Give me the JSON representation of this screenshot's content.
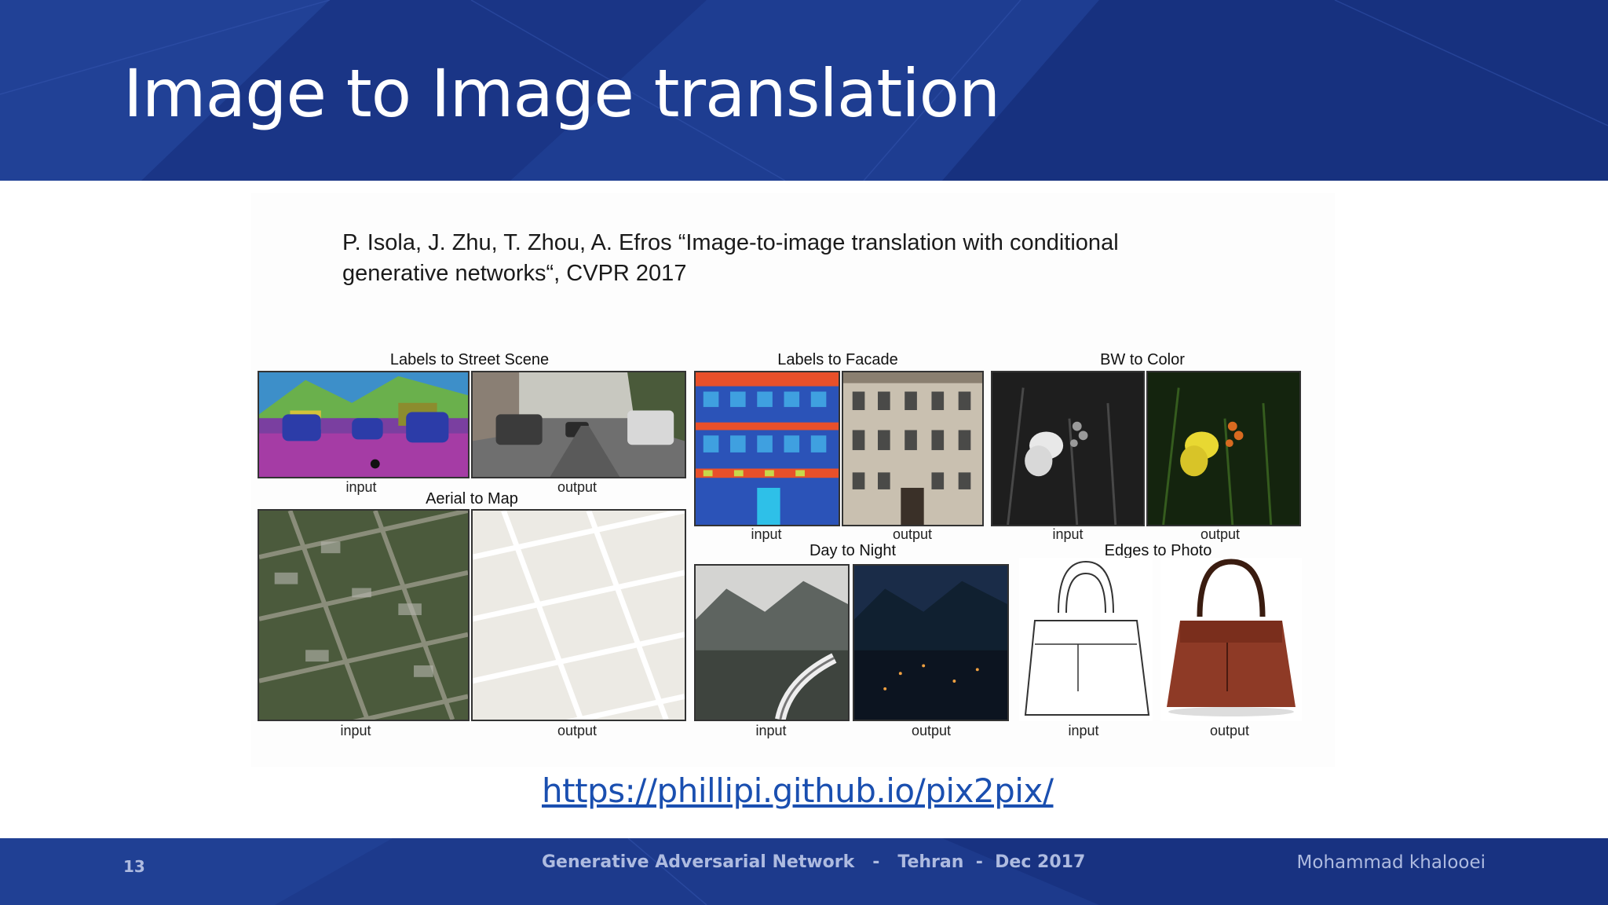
{
  "slide": {
    "title": "Image to Image translation",
    "citation_line1": "P. Isola, J. Zhu, T. Zhou, A. Efros “Image-to-image translation with conditional",
    "citation_line2": "generative networks“, CVPR 2017",
    "link": "https://phillipi.github.io/pix2pix/"
  },
  "figure": {
    "panels": [
      {
        "title": "Labels to Street Scene",
        "input": "input",
        "output": "output"
      },
      {
        "title": "Aerial to Map",
        "input": "input",
        "output": "output"
      },
      {
        "title": "Labels to Facade",
        "input": "input",
        "output": "output"
      },
      {
        "title": "BW to Color",
        "input": "input",
        "output": "output"
      },
      {
        "title": "Day to Night",
        "input": "input",
        "output": "output"
      },
      {
        "title": "Edges to Photo",
        "input": "input",
        "output": "output"
      }
    ]
  },
  "footer": {
    "page_number": "13",
    "center": "Generative Adversarial Network   -   Tehran  -  Dec 2017",
    "author": "Mohammad khalooei"
  },
  "colors": {
    "header_bg": "#1d3a8c",
    "link": "#1a4fb0",
    "footer_text": "#aebbe0"
  }
}
